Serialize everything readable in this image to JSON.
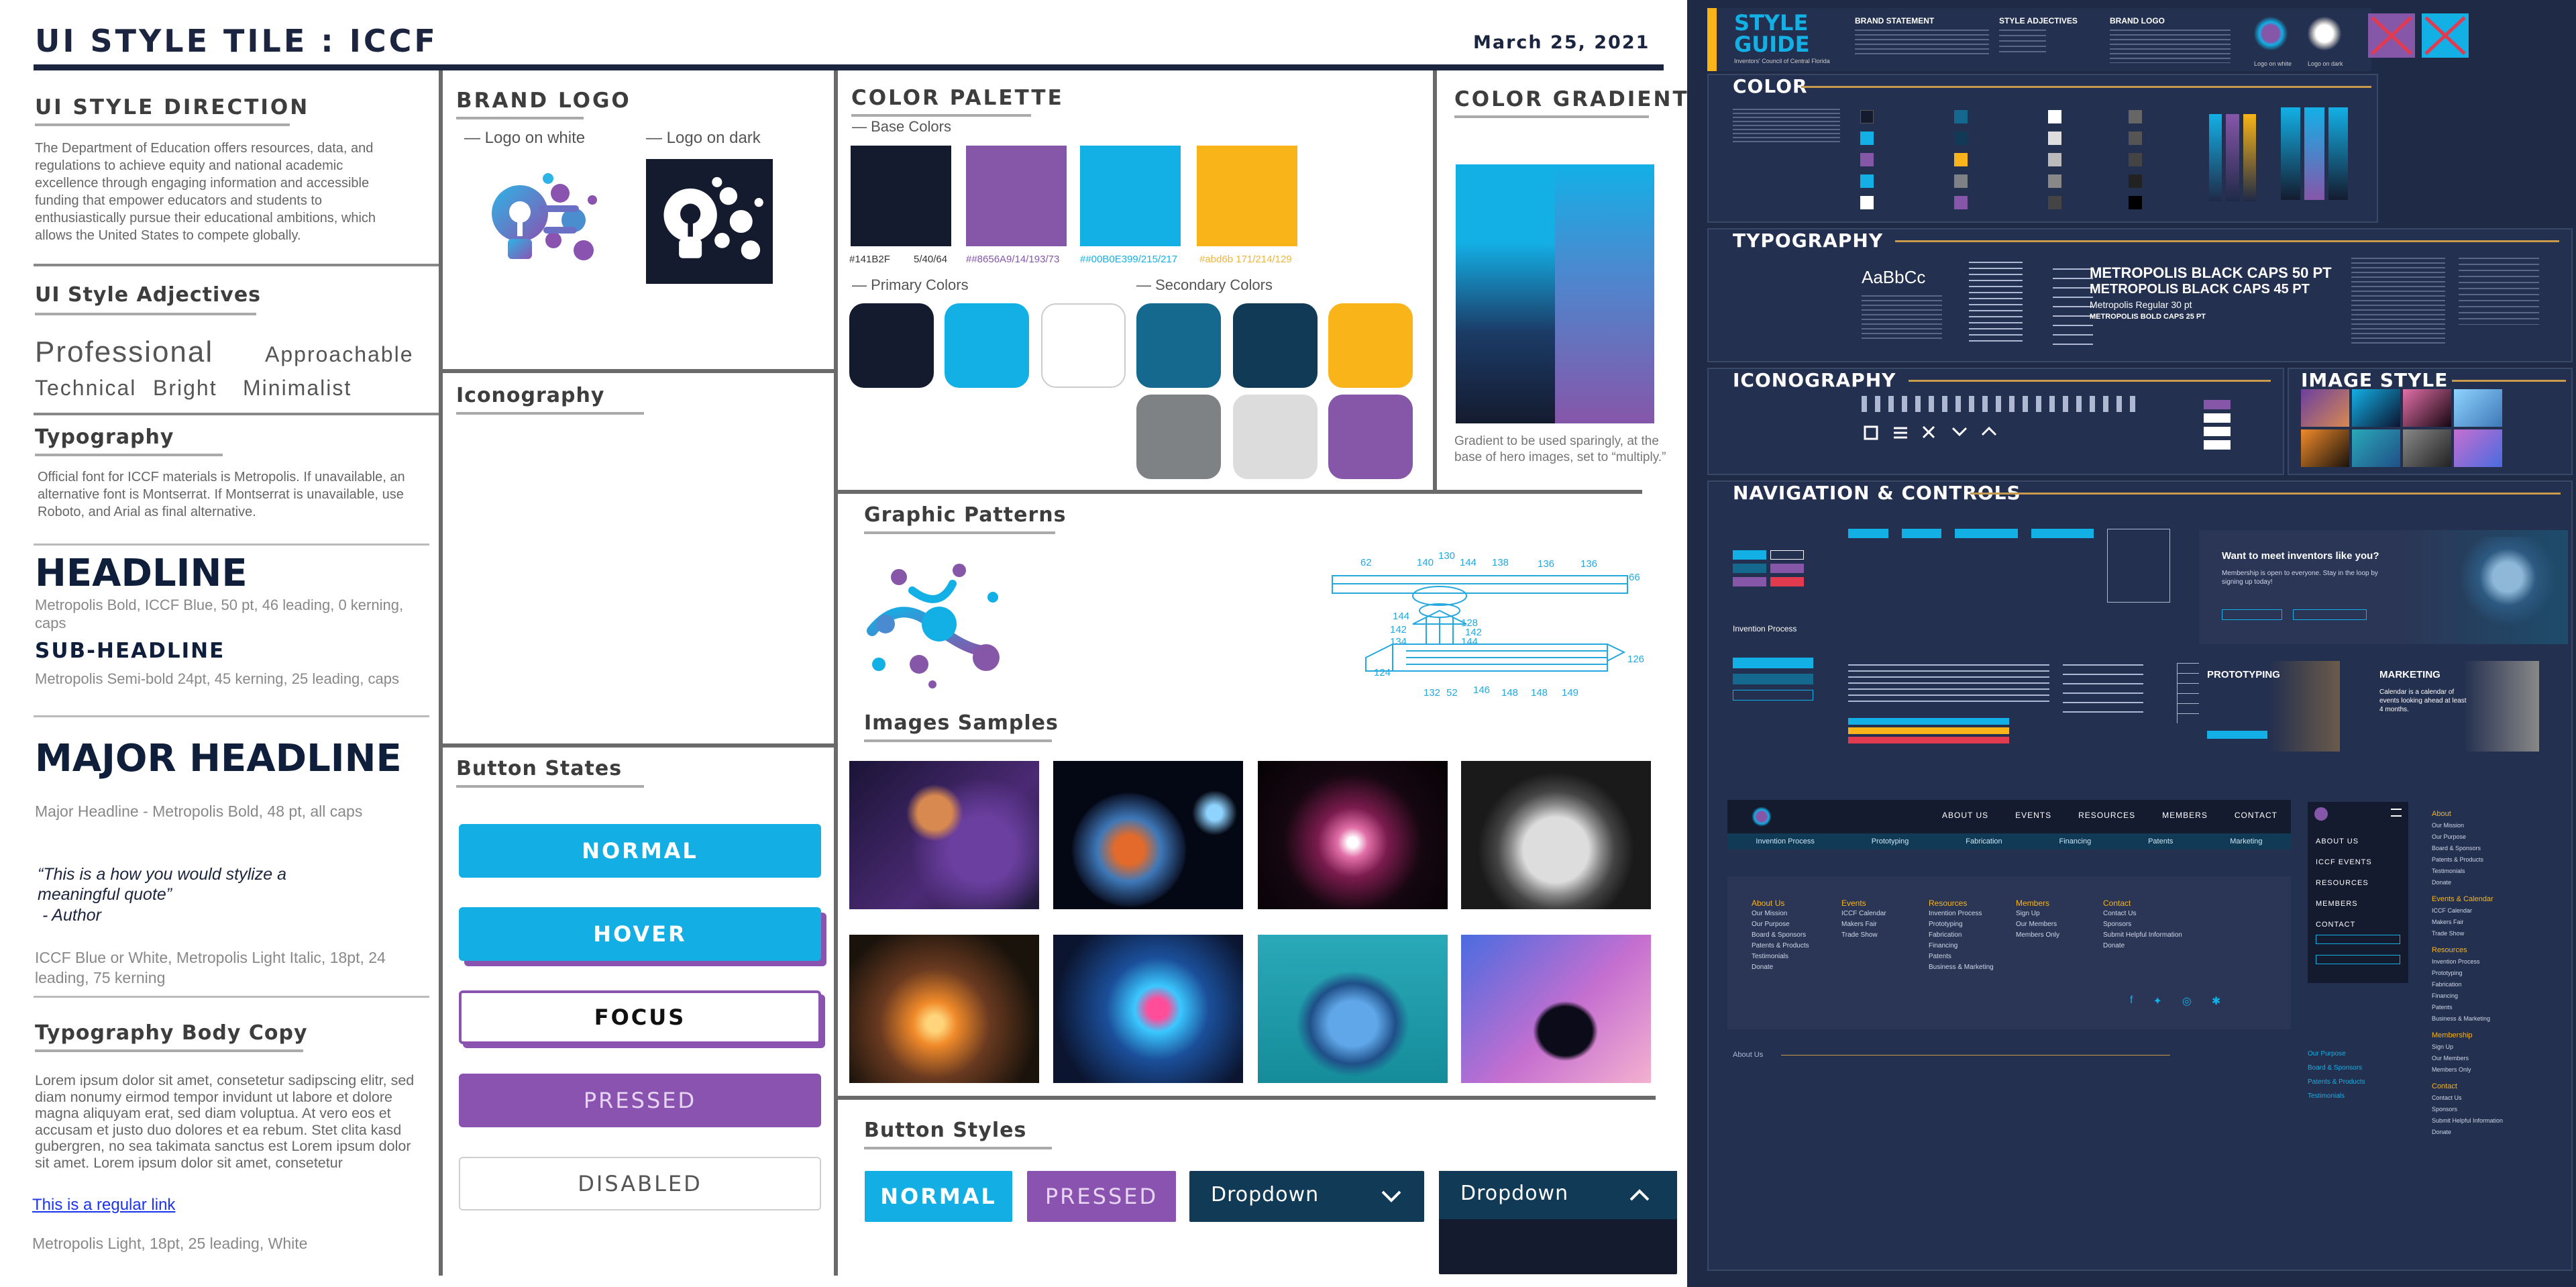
{
  "header": {
    "title": "UI STYLE TILE : ICCF",
    "date": "March 25, 2021"
  },
  "direction": {
    "heading": "UI STYLE DIRECTION",
    "body": "The Department of Education offers resources, data, and regulations to achieve equity and national academic excellence through engaging information and accessible funding that empower educators and students to enthusiastically pursue their educational ambitions, which allows the United States to compete globally."
  },
  "adjectives": {
    "heading": "UI Style Adjectives",
    "professional": "Professional",
    "approachable": "Approachable",
    "technical": "Technical",
    "bright": "Bright",
    "minimalist": "Minimalist"
  },
  "typography": {
    "heading": "Typography",
    "body": "Official font for ICCF materials is Metropolis. If unavailable, an alternative font is Montserrat. If Montserrat is unavailable, use Roboto, and Arial as final alternative.",
    "headline": "HEADLINE",
    "headline_note": "Metropolis Bold, ICCF Blue, 50 pt, 46 leading, 0 kerning, caps",
    "subheadline": "SUB-HEADLINE",
    "sub_note": "Metropolis Semi-bold 24pt, 45 kerning, 25 leading, caps",
    "major": "MAJOR HEADLINE",
    "major_note": "Major Headline - Metropolis Bold, 48 pt, all caps",
    "quote": "“This is a how you would stylize a meaningful quote”",
    "quote_author": " - Author",
    "quote_note": "ICCF Blue or White, Metropolis Light Italic, 18pt, 24 leading, 75 kerning",
    "body_heading": "Typography Body Copy",
    "lorem": "Lorem ipsum dolor sit amet, consetetur sadipscing elitr, sed diam nonumy eirmod tempor invidunt ut labore et dolore magna aliquyam erat, sed diam voluptua. At vero eos et accusam et justo duo dolores et ea rebum. Stet clita kasd gubergren, no sea takimata sanctus est Lorem ipsum dolor sit amet. Lorem ipsum dolor sit amet, consetetur",
    "link": "This is a regular link",
    "body_note": "Metropolis Light, 18pt, 25 leading, White"
  },
  "brand_logo": {
    "heading": "BRAND LOGO",
    "on_white": "Logo on white",
    "on_dark": "Logo on dark"
  },
  "iconography": {
    "heading": "Iconography"
  },
  "button_states": {
    "heading": "Button States",
    "normal": "NORMAL",
    "hover": "HOVER",
    "focus": "FOCUS",
    "pressed": "PRESSED",
    "disabled": "DISABLED"
  },
  "palette": {
    "heading": "COLOR PALETTE",
    "base_label": "Base Colors",
    "primary_label": "Primary Colors",
    "secondary_label": "Secondary Colors",
    "base": [
      {
        "color": "#141B2F",
        "label": "#141B2F"
      },
      {
        "color": "#8656A9",
        "label": "5/40/64"
      },
      {
        "color": "#00B0E3",
        "label": "##8656A9/14/193/73"
      },
      {
        "color": "#F8B418",
        "label": "##00B0E399/215/217"
      }
    ],
    "base_label_last": "#abd6b 171/214/129",
    "primary": [
      "#141B2F",
      "#13B0E6",
      "#FFFFFF"
    ],
    "secondary": [
      "#15698F",
      "#103A55",
      "#F8B418",
      "#7E8284",
      "#DCDCDC",
      "#8656A9"
    ]
  },
  "gradient": {
    "heading": "COLOR GRADIENT",
    "note": "Gradient to be used sparingly, at the base of hero images, set to “multiply.”"
  },
  "patterns": {
    "heading": "Graphic Patterns",
    "tech_labels": [
      "62",
      "140",
      "130",
      "144",
      "138",
      "136",
      "136",
      "66",
      "144",
      "128",
      "142",
      "142",
      "134",
      "144",
      "132",
      "124",
      "132",
      "52",
      "146",
      "148",
      "148",
      "149",
      "126"
    ]
  },
  "images": {
    "heading": "Images Samples"
  },
  "button_styles": {
    "heading": "Button Styles",
    "normal": "NORMAL",
    "pressed": "PRESSED",
    "dropdown1": "Dropdown",
    "dropdown2": "Dropdown"
  },
  "guide": {
    "logo_title": "STYLE GUIDE",
    "logo_sub": "Inventors' Council of Central Florida",
    "brand_statement": "BRAND STATEMENT",
    "style_adjectives": "STYLE ADJECTIVES",
    "brand_logo": "BRAND LOGO",
    "logo_on_white": "Logo on white",
    "logo_on_dark": "Logo on dark",
    "color": "COLOR",
    "typography": "TYPOGRAPHY",
    "iconography": "ICONOGRAPHY",
    "image_style": "IMAGE STYLE",
    "nav": "NAVIGATION & CONTROLS",
    "type_sample": "AaBbCc",
    "type_h1": "METROPOLIS BLACK CAPS 50 PT",
    "type_h2": "METROPOLIS BLACK CAPS 45 PT",
    "type_h3": "Metropolis Regular 30 pt",
    "type_h4": "METROPOLIS BOLD CAPS 25 PT",
    "promo_title": "Want to meet inventors like you?",
    "promo_body": "Membership is open to everyone. Stay in the loop by signing up today!",
    "prototyping": "PROTOTYPING",
    "marketing": "MARKETING",
    "marketing_body": "Calendar is a calendar of events looking ahead at least 4 months.",
    "invention_process": "Invention Process",
    "nav_items": [
      "ABOUT US",
      "EVENTS",
      "RESOURCES",
      "MEMBERS",
      "CONTACT"
    ],
    "sub_nav": [
      "Invention Process",
      "Prototyping",
      "Fabrication",
      "Financing",
      "Patents",
      "Marketing"
    ],
    "footer_cols": [
      {
        "title": "About Us",
        "items": [
          "Our Mission",
          "Our Purpose",
          "Board & Sponsors",
          "Patents & Products",
          "Testimonials",
          "Donate"
        ]
      },
      {
        "title": "Events",
        "items": [
          "ICCF Calendar",
          "Makers Fair",
          "Trade Show"
        ]
      },
      {
        "title": "Resources",
        "items": [
          "Invention Process",
          "Prototyping",
          "Fabrication",
          "Financing",
          "Patents",
          "Business & Marketing"
        ]
      },
      {
        "title": "Members",
        "items": [
          "Sign Up",
          "Our Members",
          "Members Only"
        ]
      },
      {
        "title": "Contact",
        "items": [
          "Contact Us",
          "Sponsors",
          "Submit Helpful Information",
          "Donate"
        ]
      }
    ],
    "mobile_nav": [
      "ABOUT US",
      "ICCF EVENTS",
      "RESOURCES",
      "MEMBERS",
      "CONTACT"
    ],
    "mobile_right": [
      "About",
      "Our Mission",
      "Our Purpose",
      "Board & Sponsors",
      "Patents & Products",
      "Testimonials",
      "Donate",
      "Events & Calendar",
      "ICCF Calendar",
      "Makers Fair",
      "Trade Show",
      "Resources",
      "Invention Process",
      "Prototyping",
      "Fabrication",
      "Financing",
      "Patents",
      "Business & Marketing",
      "Membership",
      "Sign Up",
      "Our Members",
      "Members Only",
      "Contact",
      "Contact Us",
      "Sponsors",
      "Submit Helpful Information",
      "Donate"
    ],
    "about_us": "About Us",
    "mobile_sub": [
      "Our Purpose",
      "Board & Sponsors",
      "Patents & Products",
      "Testimonials"
    ]
  }
}
